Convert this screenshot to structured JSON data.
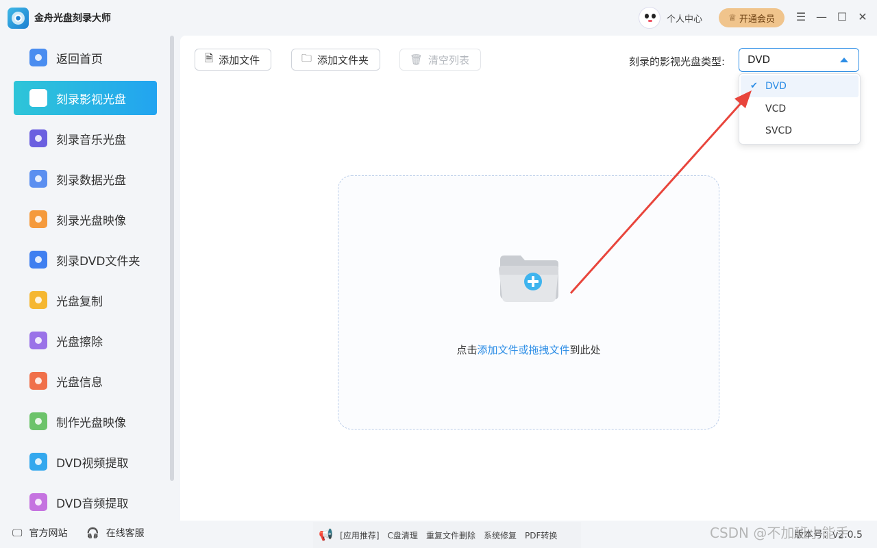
{
  "app": {
    "title": "金舟光盘刻录大师"
  },
  "header": {
    "user_label": "个人中心",
    "vip_label": "开通会员"
  },
  "sidebar": {
    "items": [
      {
        "label": "返回首页",
        "icon": "home-icon",
        "color": "#4a8df0"
      },
      {
        "label": "刻录影视光盘",
        "icon": "video-disc-icon",
        "color": "#ffffff"
      },
      {
        "label": "刻录音乐光盘",
        "icon": "music-disc-icon",
        "color": "#6b5fe0"
      },
      {
        "label": "刻录数据光盘",
        "icon": "data-disc-icon",
        "color": "#5b8ff0"
      },
      {
        "label": "刻录光盘映像",
        "icon": "disc-image-icon",
        "color": "#f59a3c"
      },
      {
        "label": "刻录DVD文件夹",
        "icon": "dvd-folder-icon",
        "color": "#3f7ff0"
      },
      {
        "label": "光盘复制",
        "icon": "disc-copy-icon",
        "color": "#f5b731"
      },
      {
        "label": "光盘擦除",
        "icon": "disc-erase-icon",
        "color": "#9a72e8"
      },
      {
        "label": "光盘信息",
        "icon": "disc-info-icon",
        "color": "#f0704a"
      },
      {
        "label": "制作光盘映像",
        "icon": "make-image-icon",
        "color": "#6cc36a"
      },
      {
        "label": "DVD视频提取",
        "icon": "dvd-video-extract-icon",
        "color": "#33a8ee"
      },
      {
        "label": "DVD音频提取",
        "icon": "dvd-audio-extract-icon",
        "color": "#c573e0"
      }
    ],
    "active_index": 1
  },
  "toolbar": {
    "add_file": "添加文件",
    "add_folder": "添加文件夹",
    "clear_list": "清空列表",
    "disc_type_label": "刻录的影视光盘类型:"
  },
  "disc_type": {
    "selected": "DVD",
    "options": [
      "DVD",
      "VCD",
      "SVCD"
    ]
  },
  "dropzone": {
    "prefix": "点击",
    "link": "添加文件或拖拽文件",
    "suffix": "到此处"
  },
  "footer": {
    "website": "官方网站",
    "support": "在线客服",
    "recommend_tag": "[应用推荐]",
    "recommend_items": [
      "C盘清理",
      "重复文件删除",
      "系统修复",
      "PDF转换"
    ],
    "version": "版本号：v2.0.5",
    "watermark": "CSDN @不加班小能手"
  },
  "colors": {
    "accent": "#2e8ee6",
    "active_gradient": [
      "#2ec5d8",
      "#22a4f0"
    ],
    "vip": "#f0c48c",
    "annotation_arrow": "#e8453c"
  }
}
